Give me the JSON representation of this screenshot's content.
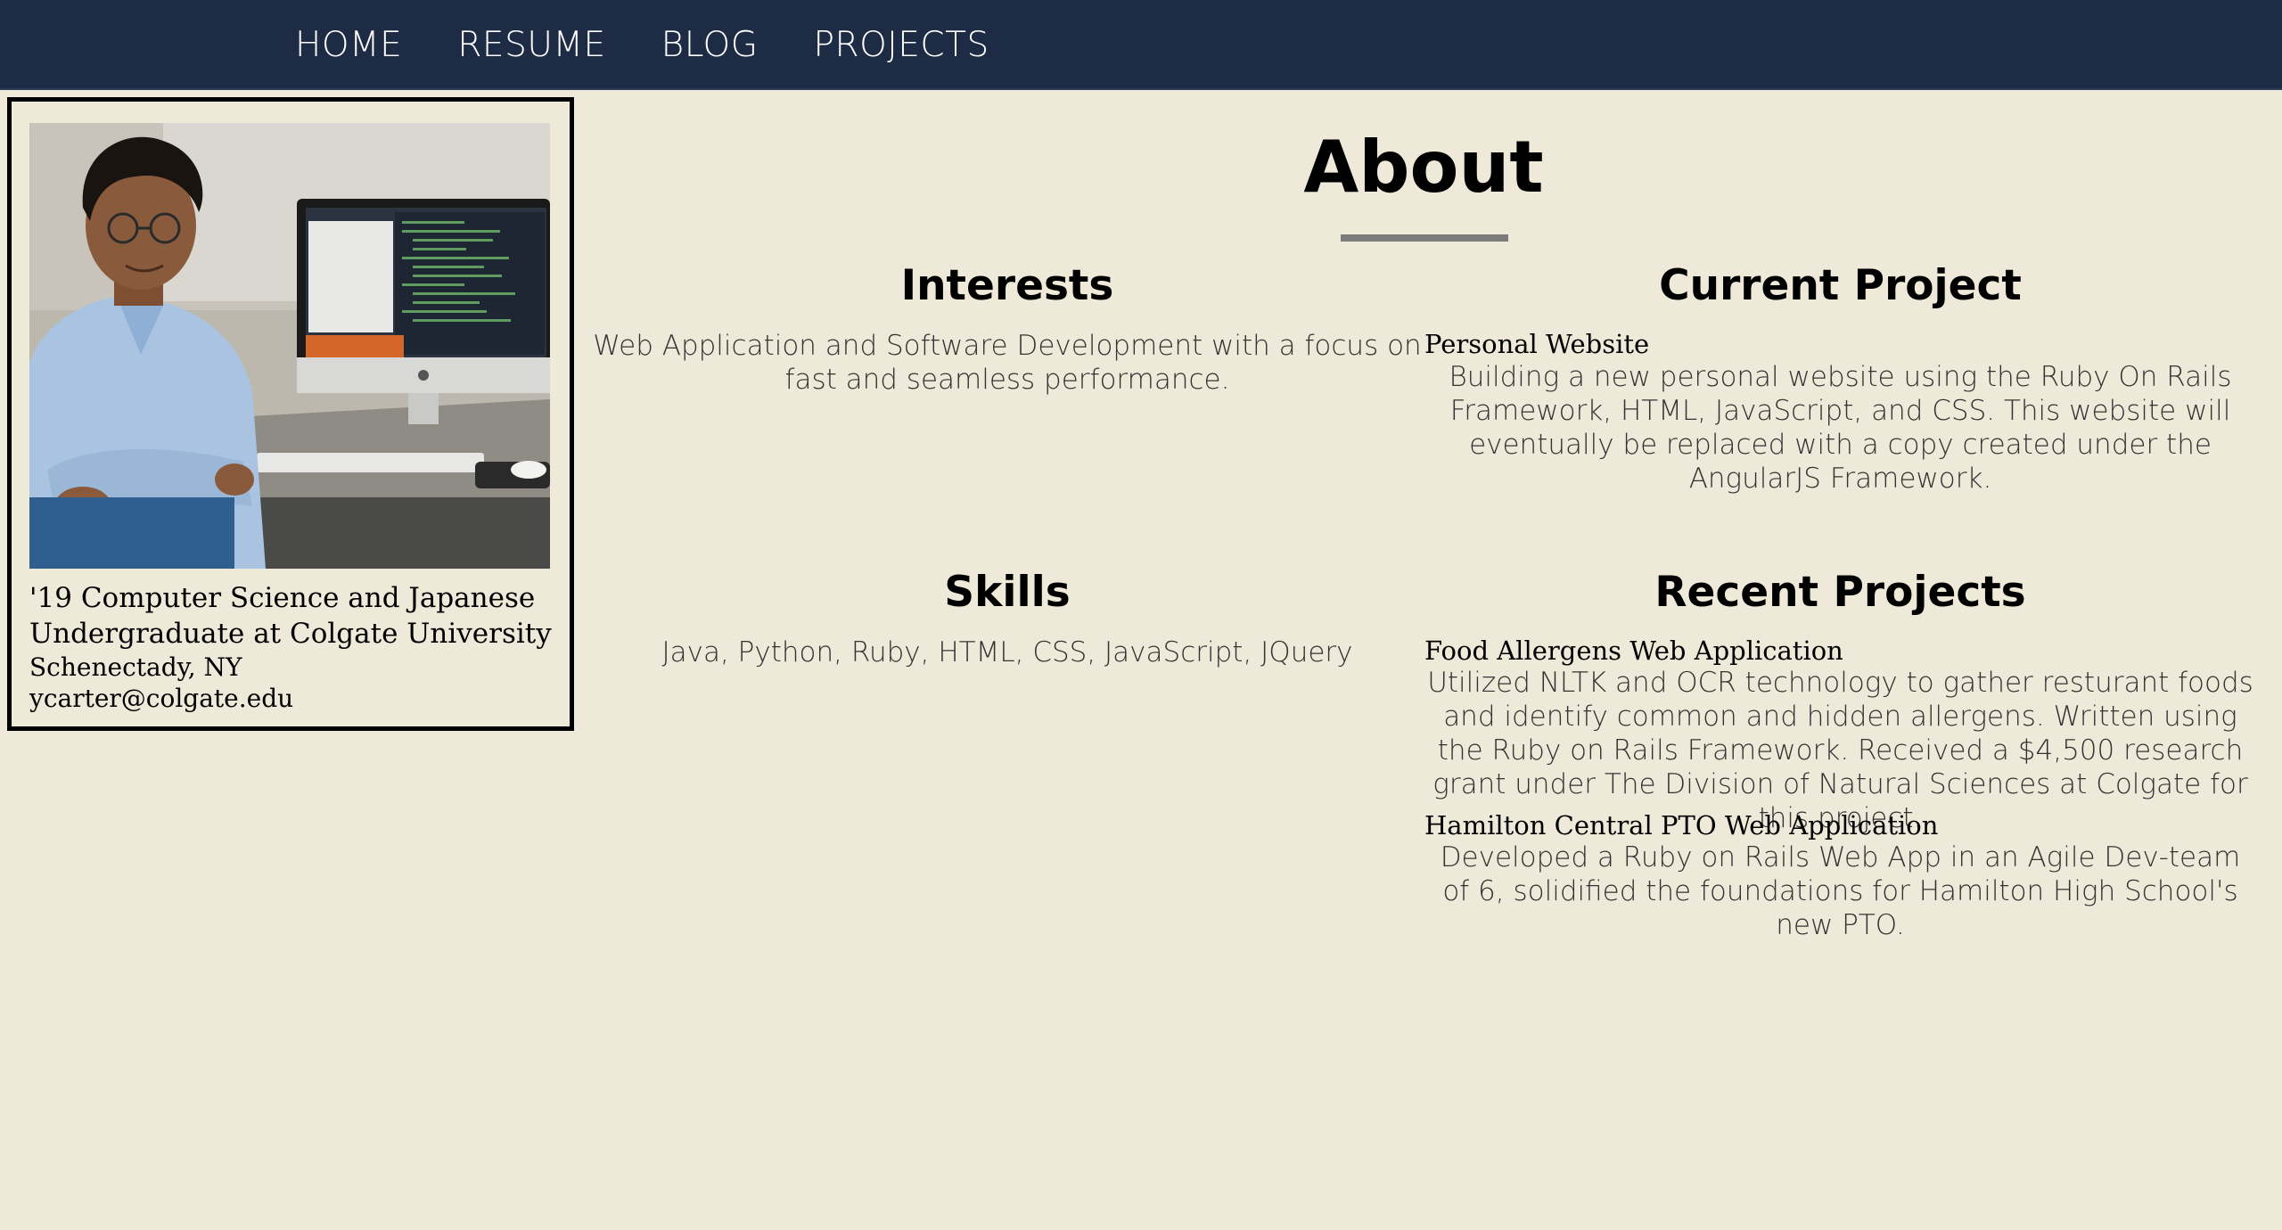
{
  "nav": {
    "items": [
      {
        "label": "HOME"
      },
      {
        "label": "RESUME"
      },
      {
        "label": "BLOG"
      },
      {
        "label": "PROJECTS"
      }
    ]
  },
  "profile": {
    "headline": "'19 Computer Science and Japanese Undergraduate at Colgate University",
    "location": "Schenectady, NY",
    "email": "ycarter@colgate.edu"
  },
  "about": {
    "title": "About"
  },
  "interests": {
    "heading": "Interests",
    "text": "Web Application and Software Development with a focus on fast and seamless performance."
  },
  "current_project": {
    "heading": "Current Project",
    "project_title": "Personal Website",
    "text": "Building a new personal website using the Ruby On Rails Framework, HTML, JavaScript, and CSS. This website will eventually be replaced with a copy created under the AngularJS Framework."
  },
  "skills": {
    "heading": "Skills",
    "text": "Java, Python, Ruby, HTML, CSS, JavaScript, JQuery"
  },
  "recent_projects": {
    "heading": "Recent Projects",
    "items": [
      {
        "title": "Food Allergens Web Application",
        "text": "Utilized NLTK and OCR technology to gather resturant foods and identify common and hidden allergens. Written using the Ruby on Rails Framework. Received a $4,500 research grant under The Division of Natural Sciences at Colgate for this project."
      },
      {
        "title": "Hamilton Central PTO Web Application",
        "text": "Developed a Ruby on Rails Web App in an Agile Dev-team of 6, solidified the foundations for Hamilton High School's new PTO."
      }
    ]
  },
  "colors": {
    "nav_bg": "#1e2b44",
    "page_bg": "#efe9d9",
    "rule": "#7b7b7b"
  }
}
